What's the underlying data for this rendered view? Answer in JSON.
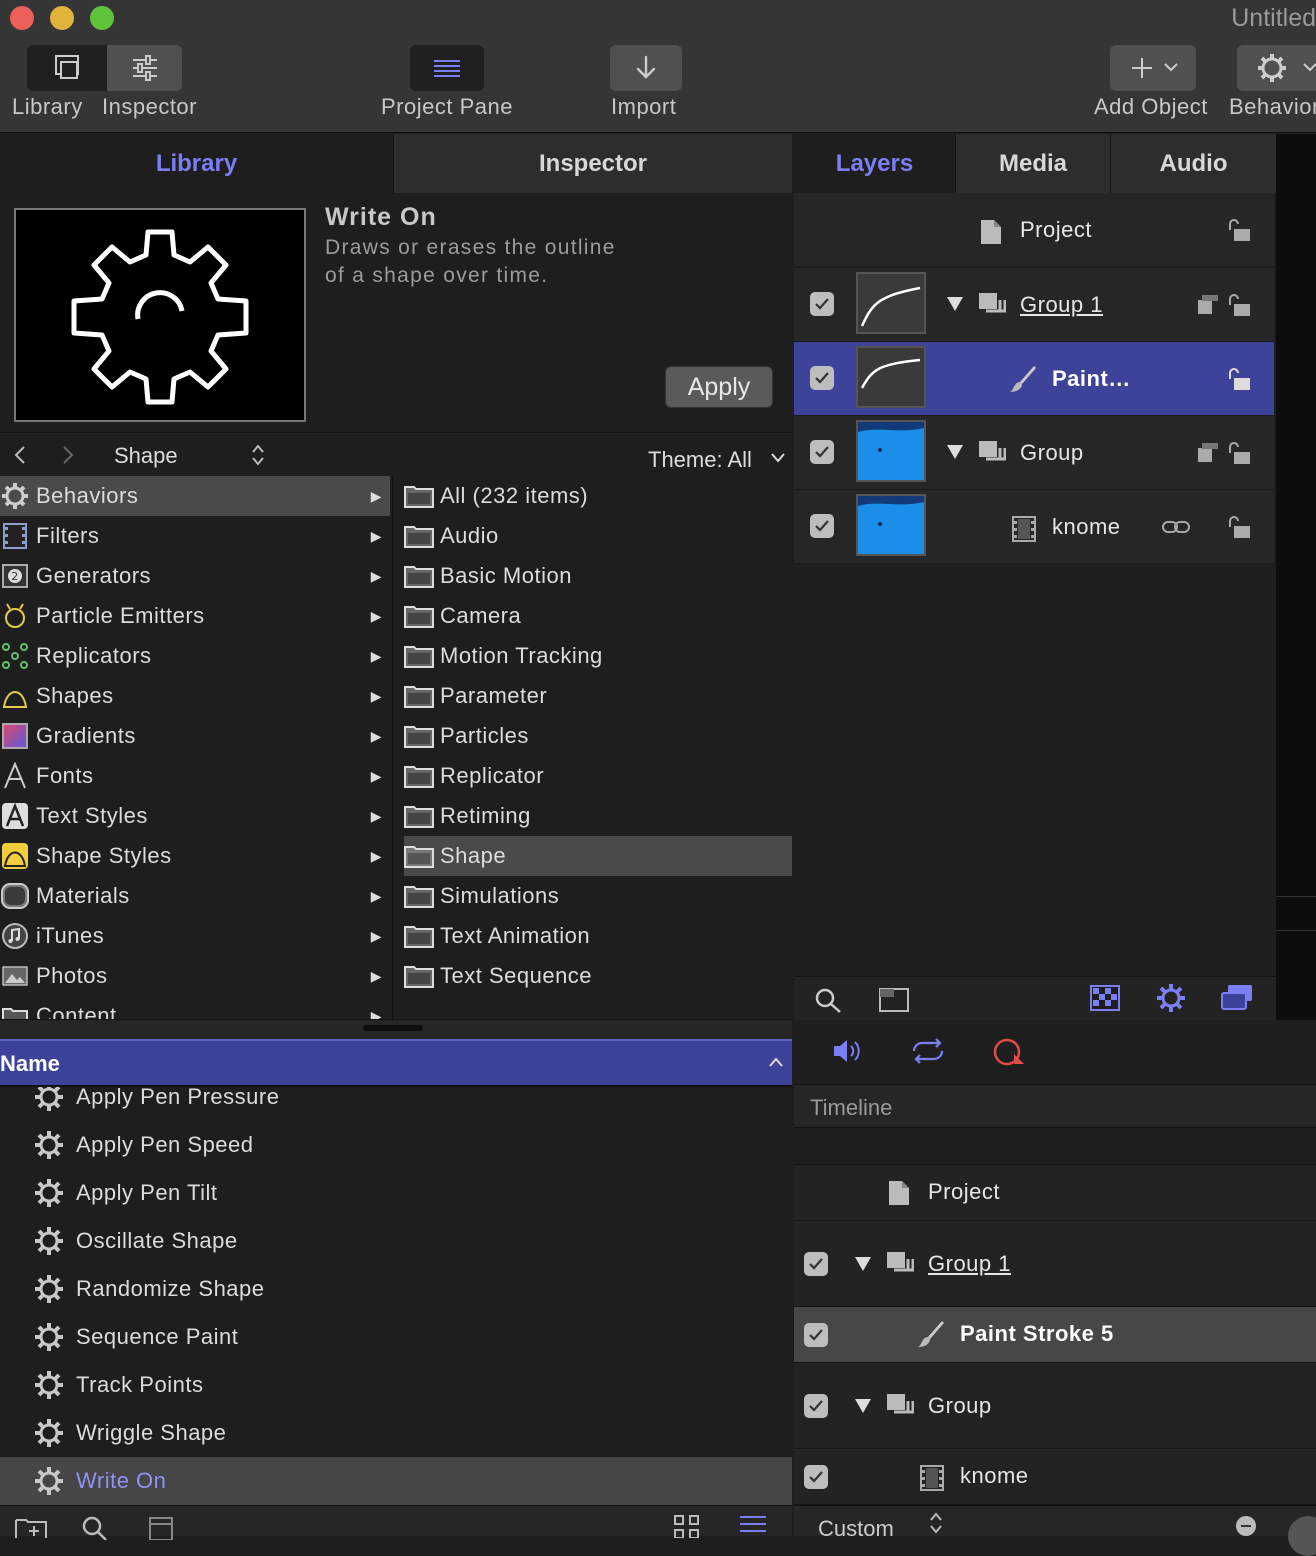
{
  "window": {
    "title": "Untitled"
  },
  "toolbar": {
    "library": "Library",
    "inspector": "Inspector",
    "project_pane": "Project Pane",
    "import": "Import",
    "add_object": "Add Object",
    "behaviors": "Behaviors"
  },
  "left_tabs": [
    "Library",
    "Inspector"
  ],
  "right_tabs": [
    "Layers",
    "Media",
    "Audio"
  ],
  "preview": {
    "title": "Write On",
    "description_line1": "Draws or erases the outline",
    "description_line2": "of a shape over time.",
    "apply": "Apply"
  },
  "browser": {
    "path": "Shape",
    "theme": "Theme: All"
  },
  "categories": [
    {
      "label": "Behaviors",
      "icon": "gear-icon"
    },
    {
      "label": "Filters",
      "icon": "filmstrip-icon"
    },
    {
      "label": "Generators",
      "icon": "generator-icon"
    },
    {
      "label": "Particle Emitters",
      "icon": "particle-emitter-icon"
    },
    {
      "label": "Replicators",
      "icon": "replicator-icon"
    },
    {
      "label": "Shapes",
      "icon": "shape-icon"
    },
    {
      "label": "Gradients",
      "icon": "gradient-icon"
    },
    {
      "label": "Fonts",
      "icon": "font-icon"
    },
    {
      "label": "Text Styles",
      "icon": "text-style-icon"
    },
    {
      "label": "Shape Styles",
      "icon": "shape-style-icon"
    },
    {
      "label": "Materials",
      "icon": "material-icon"
    },
    {
      "label": "iTunes",
      "icon": "music-note-icon"
    },
    {
      "label": "Photos",
      "icon": "photos-icon"
    },
    {
      "label": "Content",
      "icon": "folder-icon"
    }
  ],
  "folders": [
    "All (232 items)",
    "Audio",
    "Basic Motion",
    "Camera",
    "Motion Tracking",
    "Parameter",
    "Particles",
    "Replicator",
    "Retiming",
    "Shape",
    "Simulations",
    "Text Animation",
    "Text Sequence"
  ],
  "list": {
    "header": "Name",
    "items": [
      "Apply Pen Pressure",
      "Apply Pen Speed",
      "Apply Pen Tilt",
      "Oscillate Shape",
      "Randomize Shape",
      "Sequence Paint",
      "Track Points",
      "Wriggle Shape",
      "Write On"
    ]
  },
  "layers": {
    "project": "Project",
    "rows": [
      {
        "name": "Group 1"
      },
      {
        "name": "Paint…"
      },
      {
        "name": "Group"
      },
      {
        "name": "knome"
      }
    ]
  },
  "timeline": {
    "label": "Timeline",
    "project": "Project",
    "rows": [
      "Group 1",
      "Paint Stroke 5",
      "Group",
      "knome"
    ],
    "custom": "Custom"
  },
  "colors": {
    "accent": "#7b7ff5",
    "selection": "#3d4399",
    "traffic_red": "#ec5f5a",
    "traffic_yellow": "#e0b43c",
    "traffic_green": "#5fc33c"
  }
}
